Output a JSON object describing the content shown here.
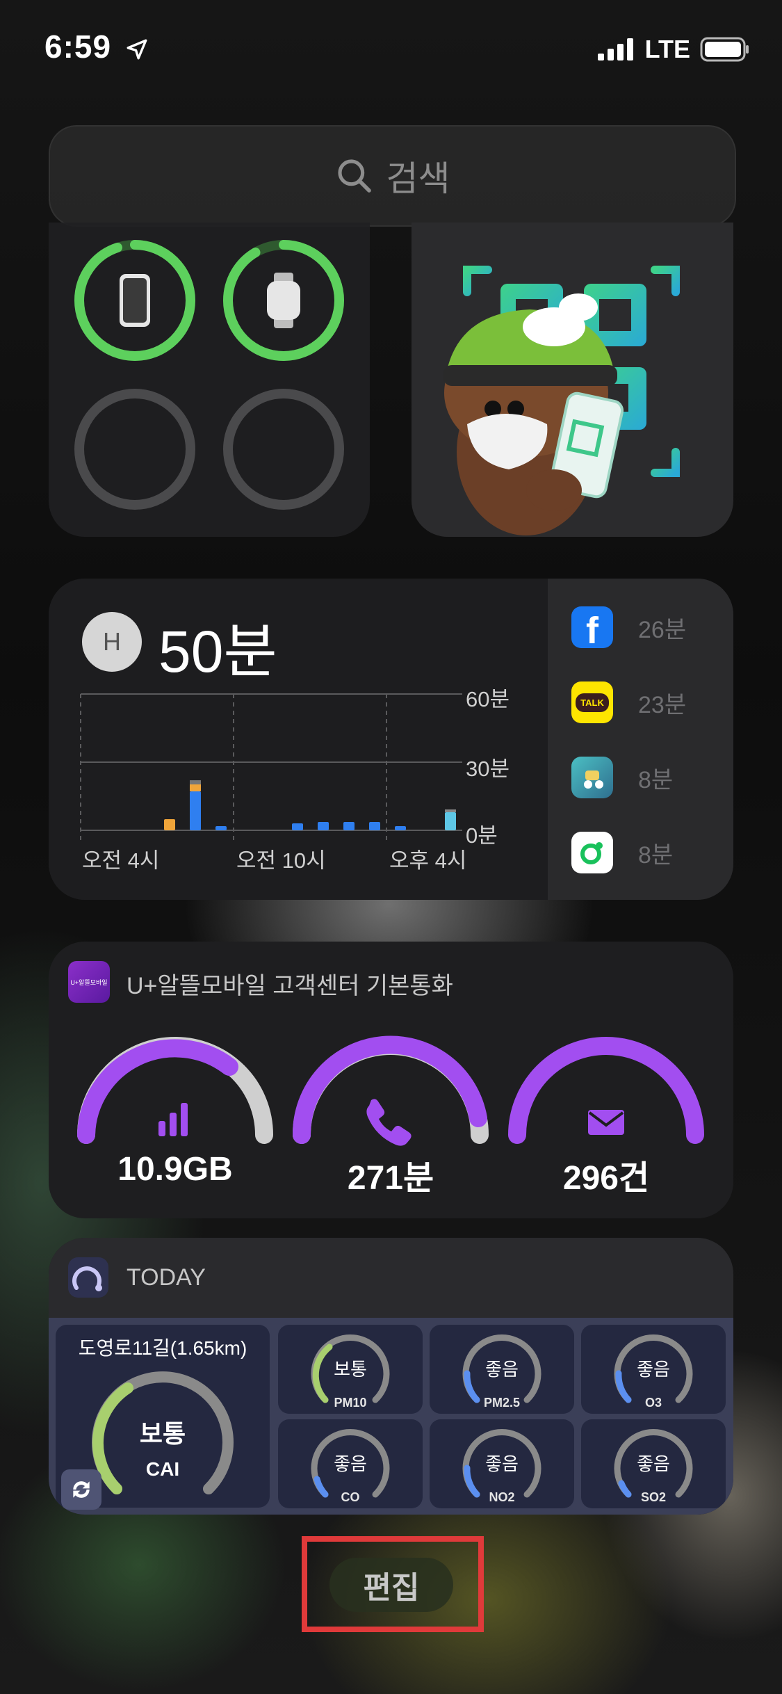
{
  "status_bar": {
    "time": "6:59",
    "network": "LTE"
  },
  "search": {
    "placeholder": "검색"
  },
  "screen_time": {
    "avatar_initial": "H",
    "total": "50분",
    "y_ticks": [
      "60분",
      "30분",
      "0분"
    ],
    "x_labels": [
      "오전 4시",
      "오전 10시",
      "오후 4시"
    ],
    "apps": [
      {
        "name": "facebook-icon",
        "time": "26분",
        "color": "#1877f2"
      },
      {
        "name": "kakaotalk-icon",
        "time": "23분",
        "color": "#fee500",
        "icon_text": "TALK"
      },
      {
        "name": "baemin-icon",
        "time": "8분",
        "color": "#4bbfc3"
      },
      {
        "name": "naver-line-icon",
        "time": "8분",
        "color": "#ffffff"
      }
    ]
  },
  "mobile": {
    "title": "U+알뜰모바일 고객센터 기본통화",
    "logo_text": "U+알뜰모바일",
    "gauges": [
      {
        "value": "10.9GB",
        "icon": "signal-bars-icon",
        "fill": 0.85
      },
      {
        "value": "271분",
        "icon": "phone-icon",
        "fill": 0.95
      },
      {
        "value": "296건",
        "icon": "envelope-icon",
        "fill": 1.0
      }
    ]
  },
  "air": {
    "title": "TODAY",
    "location": "도영로11길(1.65km)",
    "main_status": "보통",
    "main_label": "CAI",
    "cells": [
      {
        "status": "보통",
        "label": "PM10"
      },
      {
        "status": "좋음",
        "label": "PM2.5"
      },
      {
        "status": "좋음",
        "label": "O3"
      },
      {
        "status": "좋음",
        "label": "CO"
      },
      {
        "status": "좋음",
        "label": "NO2"
      },
      {
        "status": "좋음",
        "label": "SO2"
      }
    ]
  },
  "edit": {
    "label": "편집"
  }
}
